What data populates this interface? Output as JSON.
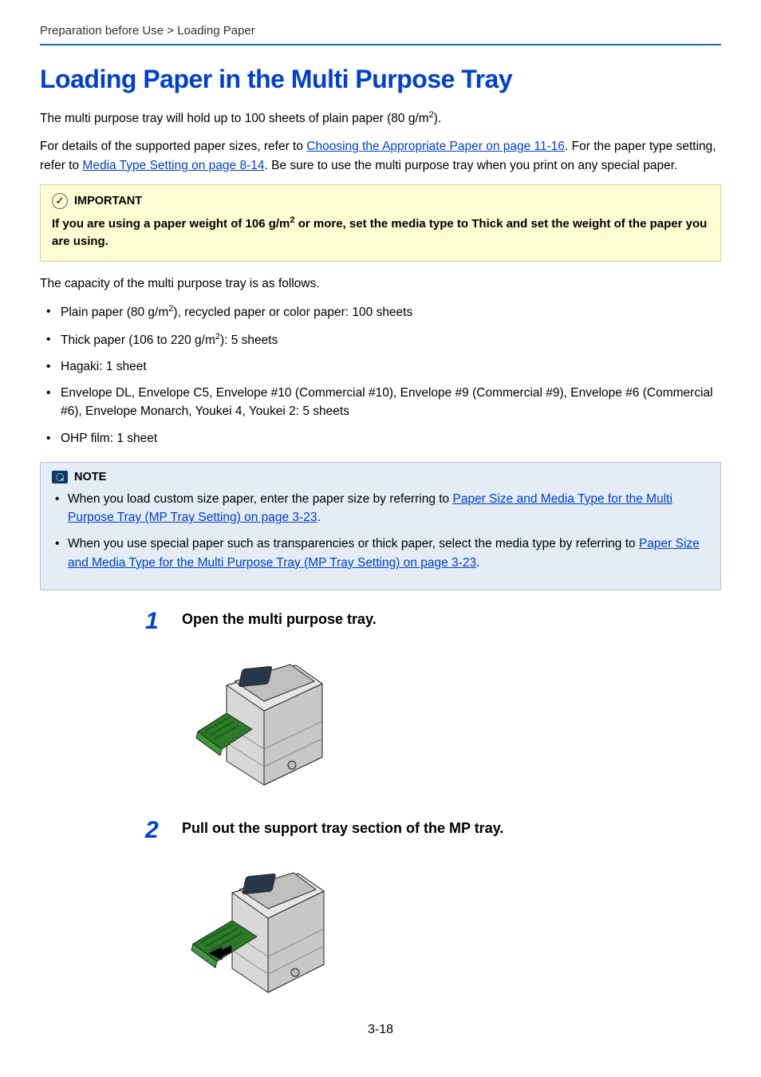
{
  "breadcrumb": "Preparation before Use > Loading Paper",
  "heading": "Loading Paper in the Multi Purpose Tray",
  "intro": {
    "line1_pre": "The multi purpose tray will hold up to 100 sheets of plain paper (80 g/m",
    "line1_sup": "2",
    "line1_post": ").",
    "line2_pre": "For details of the supported paper sizes, refer to ",
    "link1": "Choosing the Appropriate Paper on page 11-16",
    "line2_mid": ". For the paper type setting, refer to ",
    "link2": "Media Type Setting on page 8-14",
    "line2_post": ". Be sure to use the multi purpose tray when you print on any special paper."
  },
  "important": {
    "label": "IMPORTANT",
    "body_pre": "If you are using a paper weight of 106 g/m",
    "body_sup": "2",
    "body_post": " or more, set the media type to Thick and set the weight of the paper you are using."
  },
  "capacity_intro": "The capacity of the multi purpose tray is as follows.",
  "capacity_items": {
    "i0_pre": "Plain paper (80 g/m",
    "i0_sup": "2",
    "i0_post": "), recycled paper or color paper: 100 sheets",
    "i1_pre": "Thick paper (106 to 220 g/m",
    "i1_sup": "2",
    "i1_post": "): 5 sheets",
    "i2": "Hagaki: 1 sheet",
    "i3": "Envelope DL, Envelope C5, Envelope #10 (Commercial #10), Envelope #9 (Commercial #9), Envelope #6 (Commercial #6), Envelope Monarch, Youkei 4, Youkei 2: 5 sheets",
    "i4": "OHP film: 1 sheet"
  },
  "note": {
    "label": "NOTE",
    "item1_pre": "When you load custom size paper, enter the paper size by referring to ",
    "item1_link": "Paper Size and Media Type for the Multi Purpose Tray (MP Tray Setting) on page 3-23",
    "item1_post": ".",
    "item2_pre": "When you use special paper such as transparencies or thick paper, select the media type by referring to ",
    "item2_link": "Paper Size and Media Type for the Multi Purpose Tray (MP Tray Setting) on page 3-23",
    "item2_post": "."
  },
  "steps": {
    "s1_num": "1",
    "s1_title": "Open the multi purpose tray.",
    "s2_num": "2",
    "s2_title": "Pull out the support tray section of the MP tray."
  },
  "page_number": "3-18"
}
